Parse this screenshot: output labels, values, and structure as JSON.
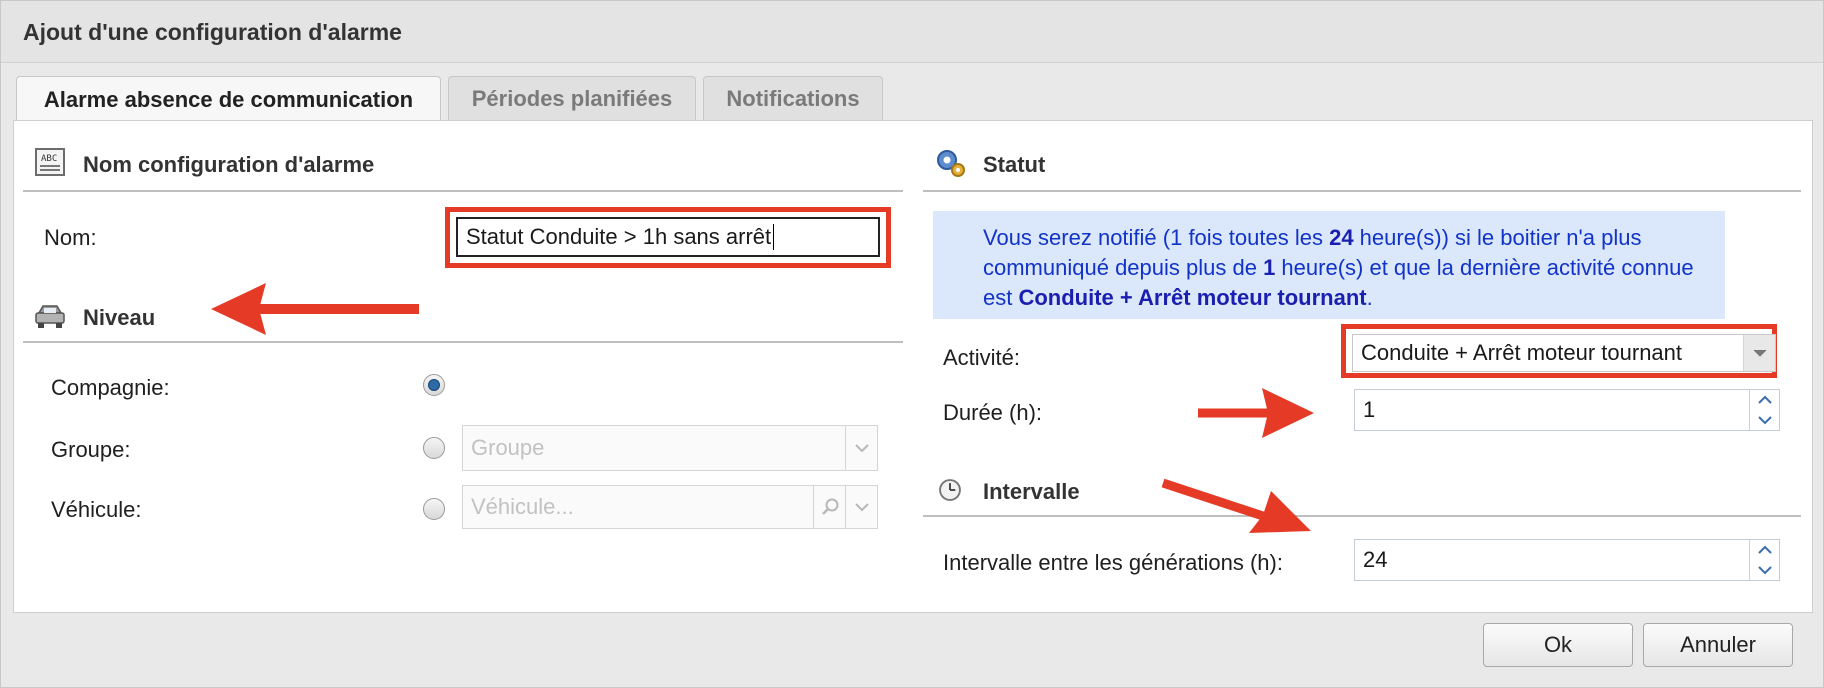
{
  "dialog": {
    "title": "Ajout d'une configuration d'alarme"
  },
  "tabs": [
    {
      "label": "Alarme absence de communication",
      "active": true
    },
    {
      "label": "Périodes planifiées",
      "active": false
    },
    {
      "label": "Notifications",
      "active": false
    }
  ],
  "left": {
    "name_section": {
      "title": "Nom configuration d'alarme",
      "icon": "abc-form-icon"
    },
    "name_field": {
      "label": "Nom:",
      "value": "Statut Conduite > 1h sans arrêt"
    },
    "niveau_section": {
      "title": "Niveau",
      "icon": "car-icon"
    },
    "levels": [
      {
        "label": "Compagnie:",
        "checked": true
      },
      {
        "label": "Groupe:",
        "checked": false,
        "placeholder": "Groupe"
      },
      {
        "label": "Véhicule:",
        "checked": false,
        "placeholder": "Véhicule..."
      }
    ]
  },
  "right": {
    "statut_section": {
      "title": "Statut",
      "icon": "gears-icon"
    },
    "info": {
      "p1": "Vous serez notifié (1 fois toutes les ",
      "b1": "24",
      "p2": " heure(s)) si le boitier n'a plus communiqué depuis plus de ",
      "b2": "1",
      "p3": " heure(s) et que la dernière activité connue est ",
      "b3": "Conduite + Arrêt moteur tournant",
      "p4": "."
    },
    "activite": {
      "label": "Activité:",
      "value": "Conduite + Arrêt moteur tournant"
    },
    "duree": {
      "label": "Durée (h):",
      "value": "1"
    },
    "intervalle_section": {
      "title": "Intervalle",
      "icon": "clock-icon"
    },
    "intervalle": {
      "label": "Intervalle entre les générations (h):",
      "value": "24"
    }
  },
  "buttons": {
    "ok": "Ok",
    "cancel": "Annuler"
  },
  "colors": {
    "annotation": "#e53a26",
    "info_bg": "#dbe8fb",
    "info_text": "#1233c8"
  }
}
